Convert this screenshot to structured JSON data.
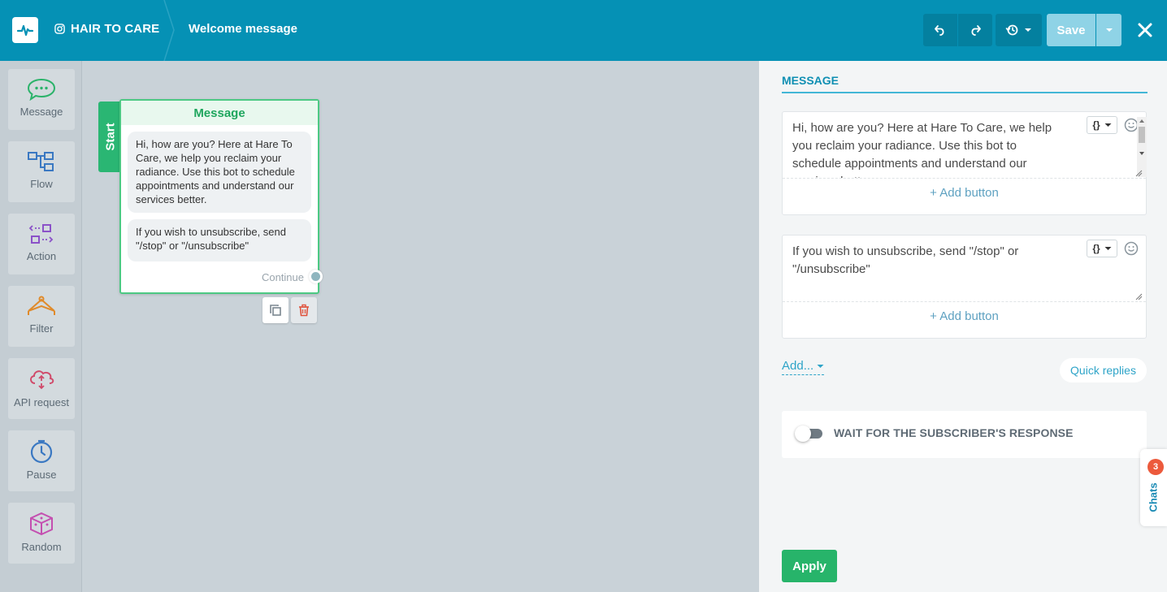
{
  "header": {
    "bot_name": "HAIR TO CARE",
    "page_title": "Welcome message",
    "save_label": "Save"
  },
  "toolbar": {
    "items": [
      {
        "label": "Message",
        "icon": "message-bubble-icon"
      },
      {
        "label": "Flow",
        "icon": "flow-icon"
      },
      {
        "label": "Action",
        "icon": "action-icon"
      },
      {
        "label": "Filter",
        "icon": "filter-icon"
      },
      {
        "label": "API request",
        "icon": "api-cloud-icon"
      },
      {
        "label": "Pause",
        "icon": "clock-icon"
      },
      {
        "label": "Random",
        "icon": "dice-icon"
      }
    ]
  },
  "canvas": {
    "start_label": "Start",
    "node": {
      "title": "Message",
      "messages": [
        "Hi, how are you? Here at Hare To Care, we help you reclaim your radiance. Use this bot to schedule appointments and understand our services better.",
        "If you wish to unsubscribe, send \"/stop\" or \"/unsubscribe\""
      ],
      "continue_label": "Continue"
    }
  },
  "panel": {
    "title": "MESSAGE",
    "messages": [
      {
        "text": "Hi, how are you? Here at Hare To Care, we help you reclaim your radiance. Use this bot to schedule appointments and understand our services better.",
        "variable_label": "{}",
        "add_button_label": "+ Add button"
      },
      {
        "text": "If you wish to unsubscribe, send \"/stop\" or \"/unsubscribe\"",
        "variable_label": "{}",
        "add_button_label": "+ Add button"
      }
    ],
    "add_menu_label": "Add...",
    "quick_replies_label": "Quick replies",
    "wait_label": "WAIT FOR THE SUBSCRIBER'S RESPONSE",
    "wait_enabled": false,
    "apply_label": "Apply"
  },
  "chats": {
    "label": "Chats",
    "count": "3"
  },
  "colors": {
    "header": "#0591b5",
    "accent_green": "#27b46a",
    "link_blue": "#2ea4c8",
    "badge_red": "#ec5a3c"
  }
}
